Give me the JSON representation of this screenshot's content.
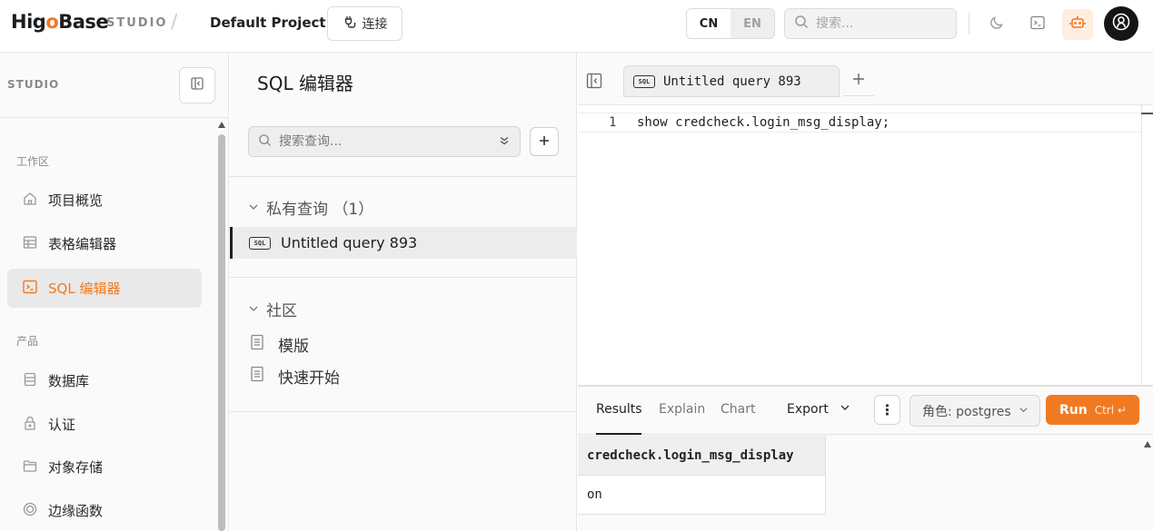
{
  "header": {
    "logo_pre": "Hig",
    "logo_o": "o",
    "logo_post": "Base",
    "studio_tag": "STUDIO",
    "separator": "/",
    "project_name": "Default Project",
    "connect_label": "连接",
    "lang_cn": "CN",
    "lang_en": "EN",
    "search_placeholder": "搜索..."
  },
  "sidebar": {
    "header_label": "STUDIO",
    "section_workspace": "工作区",
    "section_products": "产品",
    "items": [
      {
        "label": "项目概览",
        "icon": "home-icon"
      },
      {
        "label": "表格编辑器",
        "icon": "table-icon"
      },
      {
        "label": "SQL 编辑器",
        "icon": "terminal-icon",
        "active": true
      },
      {
        "label": "数据库",
        "icon": "database-icon"
      },
      {
        "label": "认证",
        "icon": "lock-icon"
      },
      {
        "label": "对象存储",
        "icon": "folder-icon"
      },
      {
        "label": "边缘函数",
        "icon": "function-icon"
      }
    ]
  },
  "queries": {
    "title": "SQL 编辑器",
    "search_placeholder": "搜索查询...",
    "private_group": "私有查询 （1）",
    "private_items": [
      {
        "label": "Untitled query 893",
        "badge": "SQL"
      }
    ],
    "community_group": "社区",
    "community_items": [
      "模版",
      "快速开始"
    ]
  },
  "editor": {
    "tab_label": "Untitled query 893",
    "tab_badge": "SQL",
    "line_number": "1",
    "code": "show credcheck.login_msg_display;"
  },
  "results": {
    "tabs": [
      "Results",
      "Explain",
      "Chart"
    ],
    "active_tab": "Results",
    "export_label": "Export",
    "more_label": "⋮",
    "role_label": "角色: postgres",
    "run_label": "Run",
    "run_shortcut": "Ctrl ↵",
    "columns": [
      "credcheck.login_msg_display"
    ],
    "rows": [
      [
        "on"
      ]
    ]
  },
  "colors": {
    "accent": "#f07a22",
    "active_nav_bg": "#e9e9e9"
  }
}
